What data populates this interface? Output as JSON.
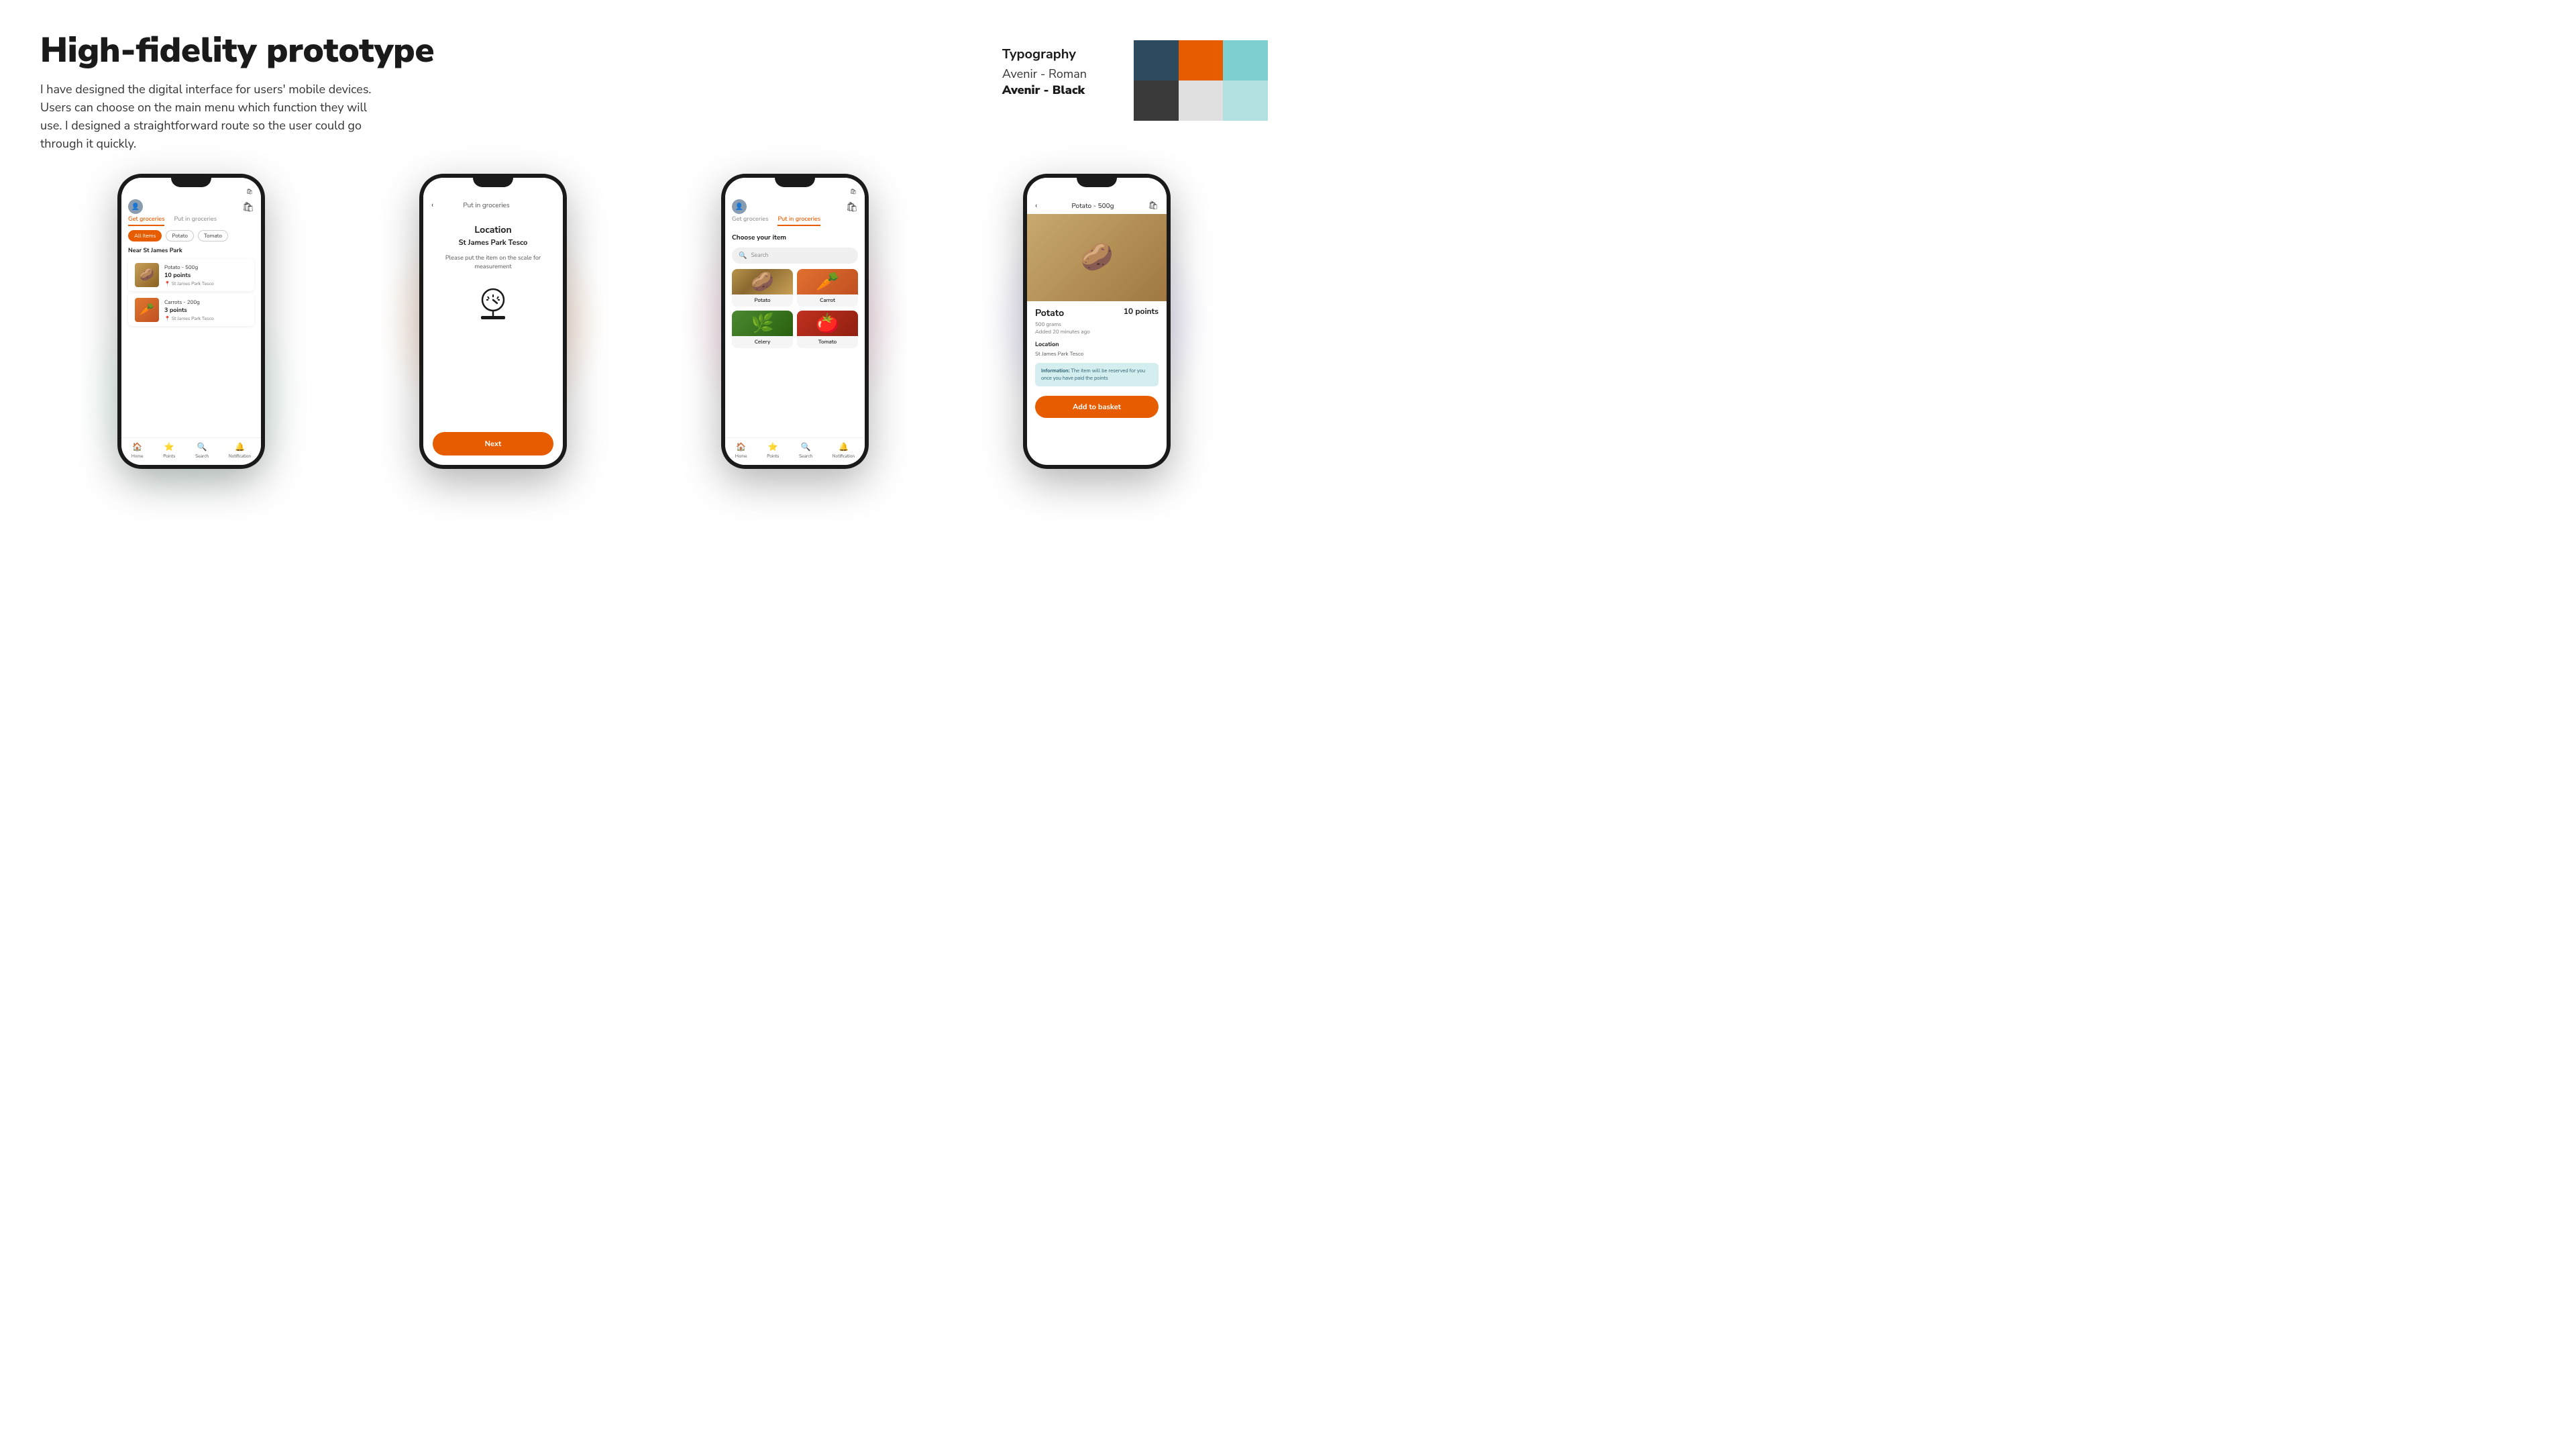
{
  "page": {
    "title": "High-fidelity prototype",
    "description": "I have designed the digital interface for users' mobile devices. Users can choose on the main menu which function they will use. I designed a straightforward route so the user could go through it quickly."
  },
  "typography": {
    "label": "Typography",
    "roman": "Avenir - Roman",
    "black": "Avenir - Black"
  },
  "colors": [
    {
      "name": "dark-blue",
      "hex": "#2d4a5e"
    },
    {
      "name": "orange",
      "hex": "#e85c00"
    },
    {
      "name": "light-blue",
      "hex": "#7ecfcf"
    },
    {
      "name": "dark-gray",
      "hex": "#3a3a3a"
    },
    {
      "name": "light-gray",
      "hex": "#e0e0e0"
    },
    {
      "name": "pale-blue",
      "hex": "#b0e0e0"
    }
  ],
  "phone1": {
    "tabs": [
      "Get groceries",
      "Put in groceries"
    ],
    "active_tab": "Get groceries",
    "filters": [
      "All Items",
      "Potato",
      "Tomato"
    ],
    "active_filter": "All Items",
    "section_title": "Near St James Park",
    "items": [
      {
        "name": "Potato - 500g",
        "points": "10 points",
        "location": "St James Park Tesco"
      },
      {
        "name": "Carrots - 200g",
        "points": "3 points",
        "location": "St James Park Tesco"
      }
    ],
    "nav": [
      "Home",
      "Points",
      "Search",
      "Notification"
    ]
  },
  "phone2": {
    "back_label": "‹",
    "page_title": "Put in groceries",
    "location_title": "Location",
    "location_name": "St James Park Tesco",
    "instruction": "Please put the item on the scale for measurement",
    "next_button": "Next"
  },
  "phone3": {
    "tabs": [
      "Get groceries",
      "Put in groceries"
    ],
    "active_tab": "Put in groceries",
    "section_title": "Choose your item",
    "search_placeholder": "Search",
    "items": [
      "Potato",
      "Carrot",
      "Celery",
      "Tomato"
    ],
    "nav": [
      "Home",
      "Points",
      "Search",
      "Notification"
    ]
  },
  "phone4": {
    "back_label": "‹",
    "page_title": "Potato - 500g",
    "product_name": "Potato",
    "points": "10 points",
    "weight": "500 grams",
    "added_time": "Added 20 minutes ago",
    "location_label": "Location",
    "location_value": "St James Park Tesco",
    "info_label": "Information:",
    "info_text": "The item will be reserved for you once you have paid the points",
    "add_button": "Add to basket"
  }
}
